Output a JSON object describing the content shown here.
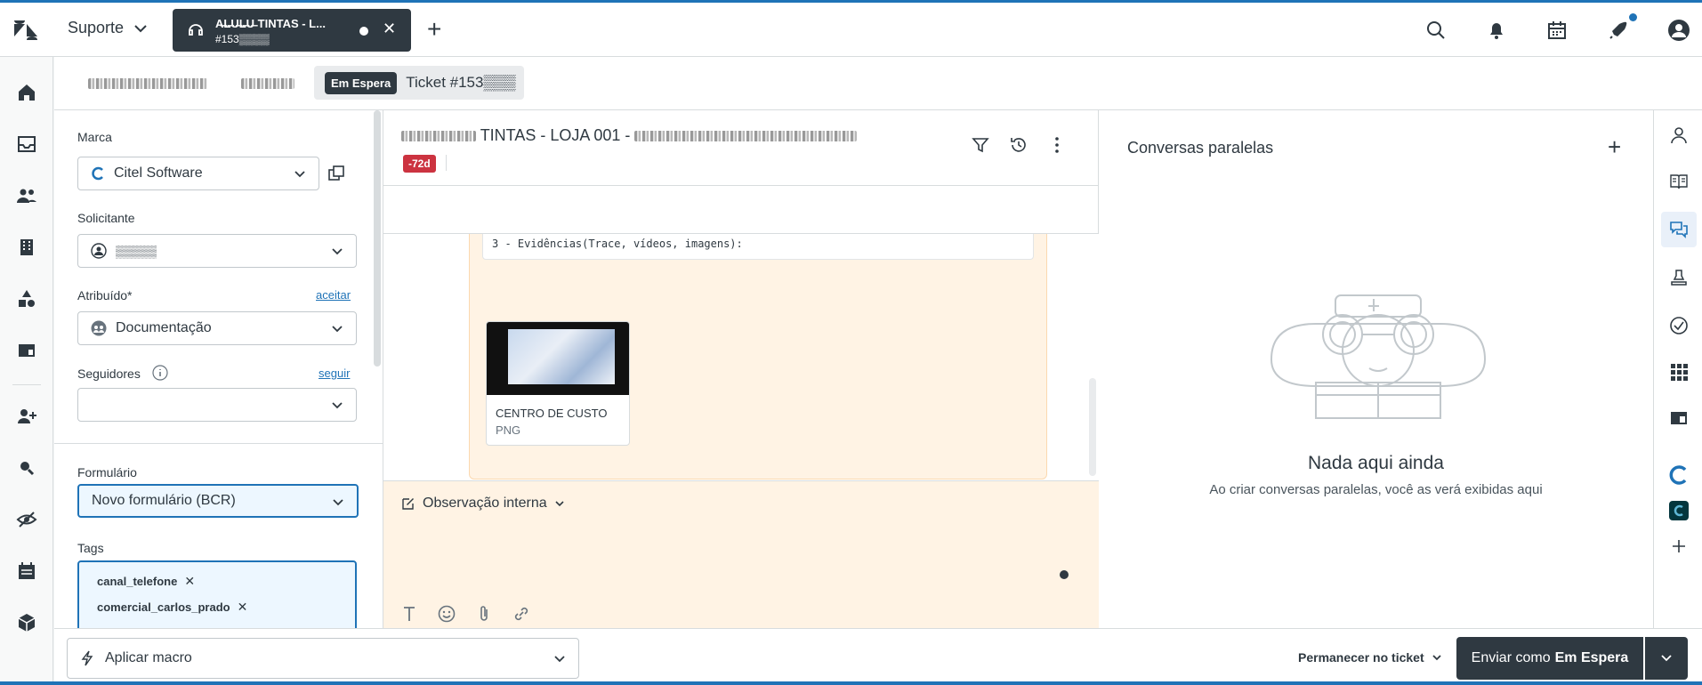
{
  "header": {
    "product_label": "Suporte",
    "active_tab": {
      "title": "A̶L̶U̶L̶U̶ TINTAS - L...",
      "id": "#153▒▒▒▒"
    }
  },
  "subtabs": {
    "status": "Em Espera",
    "ticket_label": "Ticket #153▒▒▒"
  },
  "properties": {
    "brand_label": "Marca",
    "brand_value": "Citel Software",
    "requester_label": "Solicitante",
    "requester_value": "▒▒▒▒▒",
    "assignee_label": "Atribuído*",
    "assignee_link": "aceitar",
    "assignee_value": "Documentação",
    "followers_label": "Seguidores",
    "followers_link": "seguir",
    "form_label": "Formulário",
    "form_value": "Novo formulário (BCR)",
    "tags_label": "Tags",
    "tags": [
      "canal_telefone",
      "comercial_carlos_prado"
    ]
  },
  "conversation": {
    "title_visible": "TINTAS - LOJA 001 -",
    "age_badge": "-72d",
    "code_line": "3 - Evidências(Trace, vídeos, imagens):",
    "attachment": {
      "name": "CENTRO DE CUSTO",
      "type": "PNG"
    },
    "composer_mode": "Observação interna"
  },
  "side_conversations": {
    "title": "Conversas paralelas",
    "empty_title": "Nada aqui ainda",
    "empty_subtitle": "Ao criar conversas paralelas, você as verá exibidas aqui"
  },
  "bottombar": {
    "macro_placeholder": "Aplicar macro",
    "stay_label": "Permanecer no ticket",
    "submit_prefix": "Enviar como",
    "submit_status": "Em Espera"
  },
  "colors": {
    "accent": "#1f73b7",
    "dark": "#2f3941",
    "danger": "#cc3340",
    "note_bg": "#fff3e4"
  }
}
